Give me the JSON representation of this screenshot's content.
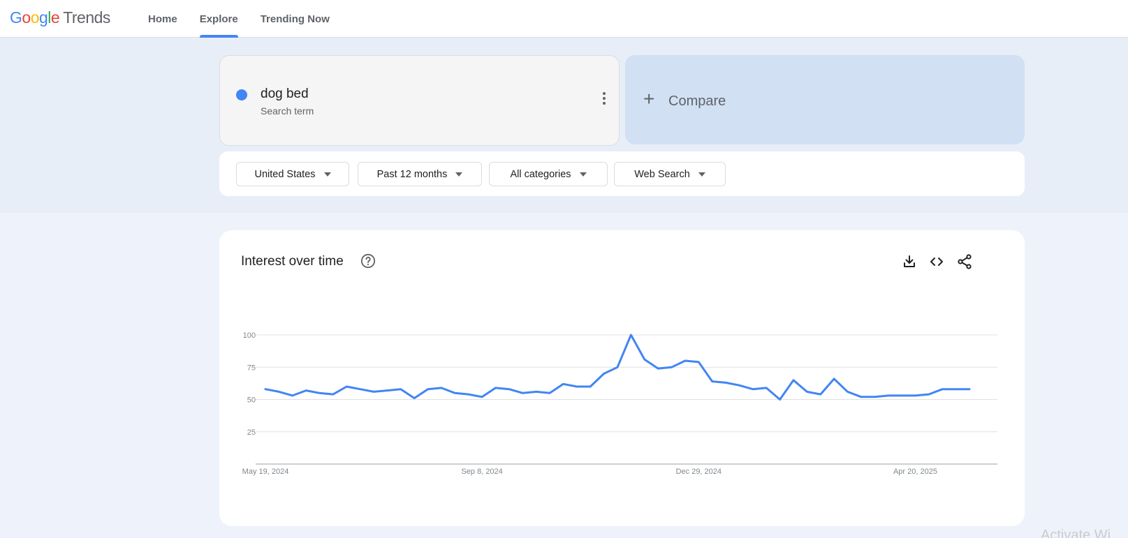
{
  "header": {
    "logo": {
      "google": "Google",
      "trends": "Trends"
    },
    "nav": [
      {
        "label": "Home",
        "active": false
      },
      {
        "label": "Explore",
        "active": true
      },
      {
        "label": "Trending Now",
        "active": false
      }
    ]
  },
  "search_term": {
    "name": "dog bed",
    "subtitle": "Search term",
    "color": "#4285f4",
    "menu_icon": "more-vert-icon"
  },
  "compare": {
    "label": "Compare",
    "icon": "plus-icon"
  },
  "filters": [
    {
      "label": "United States"
    },
    {
      "label": "Past 12 months"
    },
    {
      "label": "All categories"
    },
    {
      "label": "Web Search"
    }
  ],
  "panel": {
    "title": "Interest over time",
    "help_icon": "help-circle-icon",
    "tools": [
      "download-icon",
      "embed-code-icon",
      "share-icon"
    ]
  },
  "chart_data": {
    "type": "line",
    "title": "Interest over time",
    "ylim": [
      0,
      100
    ],
    "y_ticks": [
      25,
      50,
      75,
      100
    ],
    "x_tick_labels": [
      "May 19, 2024",
      "Sep 8, 2024",
      "Dec 29, 2024",
      "Apr 20, 2025"
    ],
    "x_tick_indices": [
      0,
      16,
      32,
      48
    ],
    "grid": true,
    "series": [
      {
        "color": "#4285f4",
        "values": [
          58,
          56,
          53,
          57,
          55,
          54,
          60,
          58,
          56,
          57,
          58,
          51,
          58,
          59,
          55,
          54,
          52,
          59,
          58,
          55,
          56,
          55,
          62,
          60,
          60,
          70,
          75,
          100,
          81,
          74,
          75,
          80,
          79,
          64,
          63,
          61,
          58,
          59,
          50,
          65,
          56,
          54,
          66,
          56,
          52,
          52,
          53,
          53,
          53,
          54,
          58,
          58,
          58
        ]
      }
    ]
  },
  "watermark": "Activate Wi"
}
